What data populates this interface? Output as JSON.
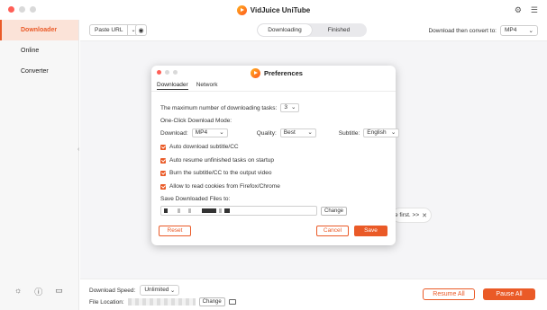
{
  "app": {
    "title": "VidJuice UniTube",
    "accent": "#ea5a27"
  },
  "sidebar": {
    "items": [
      {
        "label": "Downloader",
        "active": true
      },
      {
        "label": "Online",
        "active": false
      },
      {
        "label": "Converter",
        "active": false
      }
    ],
    "bottom_icons": [
      "theme-icon",
      "help-icon",
      "feedback-icon"
    ]
  },
  "toolbar": {
    "paste_url_label": "Paste URL",
    "tabs": [
      {
        "label": "Downloading",
        "active": true
      },
      {
        "label": "Finished",
        "active": false
      }
    ],
    "convert_label": "Download then convert to:",
    "convert_value": "MP4"
  },
  "hint": {
    "text": "e first. >>"
  },
  "bottom": {
    "speed_label": "Download Speed:",
    "speed_value": "Unlimited",
    "location_label": "File Location:",
    "change_label": "Change",
    "resume_all": "Resume All",
    "pause_all": "Pause All"
  },
  "dialog": {
    "title": "Preferences",
    "tabs": [
      {
        "label": "Downloader",
        "active": true
      },
      {
        "label": "Network",
        "active": false
      }
    ],
    "max_tasks_label": "The maximum number of downloading tasks:",
    "max_tasks_value": "3",
    "one_click_label": "One-Click Download Mode:",
    "download_label": "Download:",
    "download_value": "MP4",
    "quality_label": "Quality:",
    "quality_value": "Best",
    "subtitle_label": "Subtitle:",
    "subtitle_value": "English",
    "checkboxes": [
      "Auto download subtitle/CC",
      "Auto resume unfinished tasks on startup",
      "Burn the subtitle/CC to the output video",
      "Allow to read cookies from Firefox/Chrome"
    ],
    "save_files_label": "Save Downloaded Files to:",
    "change_label": "Change",
    "reset_label": "Reset",
    "cancel_label": "Cancel",
    "save_label": "Save"
  }
}
